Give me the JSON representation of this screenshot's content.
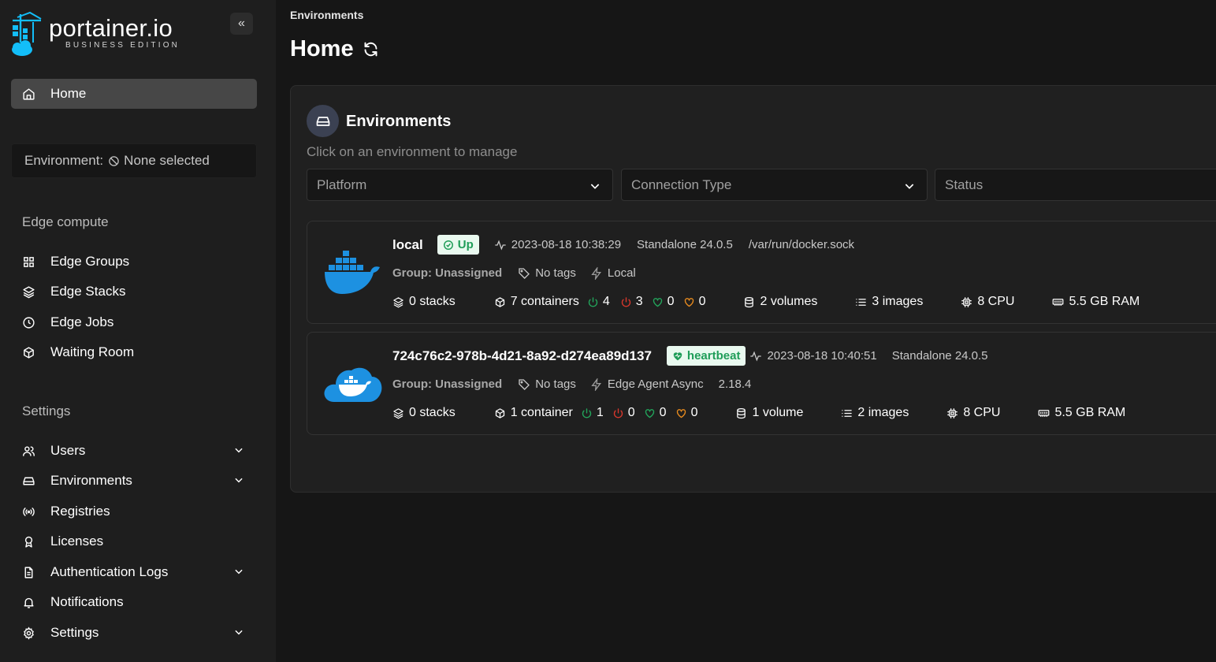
{
  "sidebar": {
    "brand": "portainer.io",
    "brand_sub": "BUSINESS EDITION",
    "collapse_icon": "«",
    "home": "Home",
    "environment_label": "Environment:",
    "environment_value": "None selected",
    "edge_title": "Edge compute",
    "edge_items": [
      "Edge Groups",
      "Edge Stacks",
      "Edge Jobs",
      "Waiting Room"
    ],
    "settings_title": "Settings",
    "settings_items": [
      "Users",
      "Environments",
      "Registries",
      "Licenses",
      "Authentication Logs",
      "Notifications",
      "Settings"
    ]
  },
  "header": {
    "breadcrumb": "Environments",
    "title": "Home"
  },
  "panel": {
    "title": "Environments",
    "subtitle": "Click on an environment to manage",
    "filters": [
      "Platform",
      "Connection Type",
      "Status"
    ]
  },
  "environments": [
    {
      "name": "local",
      "status": "Up",
      "timestamp": "2023-08-18 10:38:29",
      "type": "Standalone 24.0.5",
      "url": "/var/run/docker.sock",
      "group": "Group: Unassigned",
      "tags": "No tags",
      "connection": "Local",
      "agent_version": "",
      "stacks": "0 stacks",
      "containers": "7 containers",
      "running": "4",
      "stopped": "3",
      "healthy": "0",
      "unhealthy": "0",
      "volumes": "2 volumes",
      "images": "3 images",
      "cpu": "8 CPU",
      "ram": "5.5 GB RAM"
    },
    {
      "name": "724c76c2-978b-4d21-8a92-d274ea89d137",
      "status": "heartbeat",
      "timestamp": "2023-08-18 10:40:51",
      "type": "Standalone 24.0.5",
      "url": "",
      "group": "Group: Unassigned",
      "tags": "No tags",
      "connection": "Edge Agent Async",
      "agent_version": "2.18.4",
      "stacks": "0 stacks",
      "containers": "1 container",
      "running": "1",
      "stopped": "0",
      "healthy": "0",
      "unhealthy": "0",
      "volumes": "1 volume",
      "images": "2 images",
      "cpu": "8 CPU",
      "ram": "5.5 GB RAM"
    }
  ],
  "colors": {
    "accent_blue": "#1d91e1",
    "running_green": "#22a55b",
    "stopped_red": "#d7372c",
    "healthy_green": "#22a55b",
    "unhealthy_orange": "#e78b1f"
  }
}
